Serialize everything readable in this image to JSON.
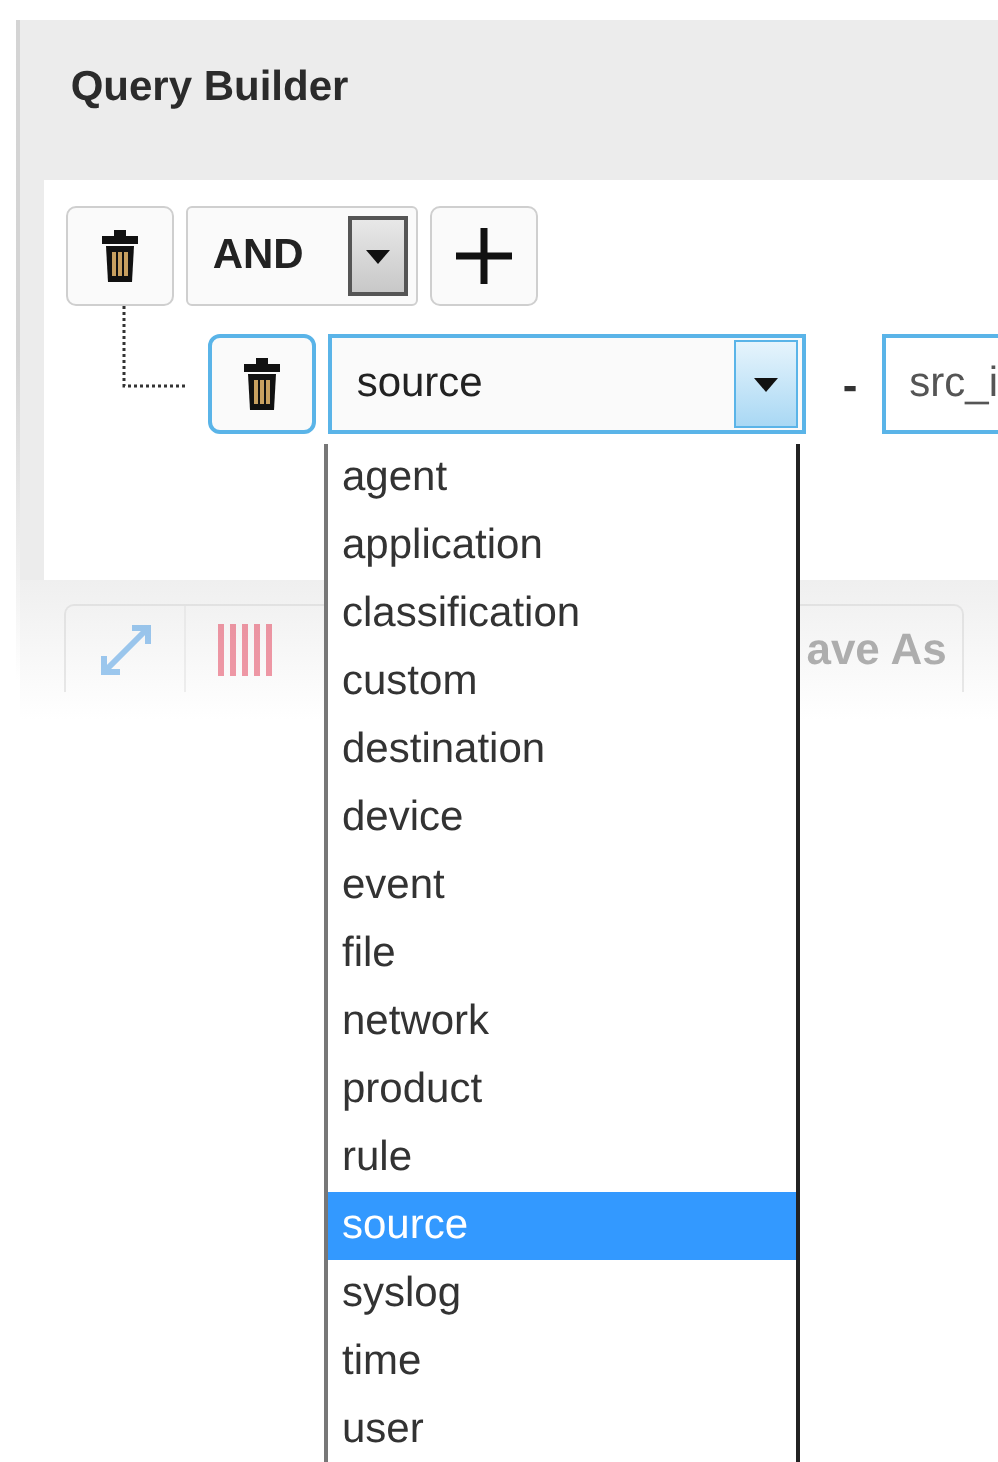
{
  "panel": {
    "title": "Query Builder"
  },
  "group": {
    "operator": "AND"
  },
  "rule": {
    "field": "source",
    "separator": "-",
    "value": "src_i"
  },
  "dropdown": {
    "options": [
      {
        "label": "agent",
        "selected": false
      },
      {
        "label": "application",
        "selected": false
      },
      {
        "label": "classification",
        "selected": false
      },
      {
        "label": "custom",
        "selected": false
      },
      {
        "label": "destination",
        "selected": false
      },
      {
        "label": "device",
        "selected": false
      },
      {
        "label": "event",
        "selected": false
      },
      {
        "label": "file",
        "selected": false
      },
      {
        "label": "network",
        "selected": false
      },
      {
        "label": "product",
        "selected": false
      },
      {
        "label": "rule",
        "selected": false
      },
      {
        "label": "source",
        "selected": true
      },
      {
        "label": "syslog",
        "selected": false
      },
      {
        "label": "time",
        "selected": false
      },
      {
        "label": "user",
        "selected": false
      }
    ]
  },
  "toolbar": {
    "save_as_button": "ave As"
  }
}
